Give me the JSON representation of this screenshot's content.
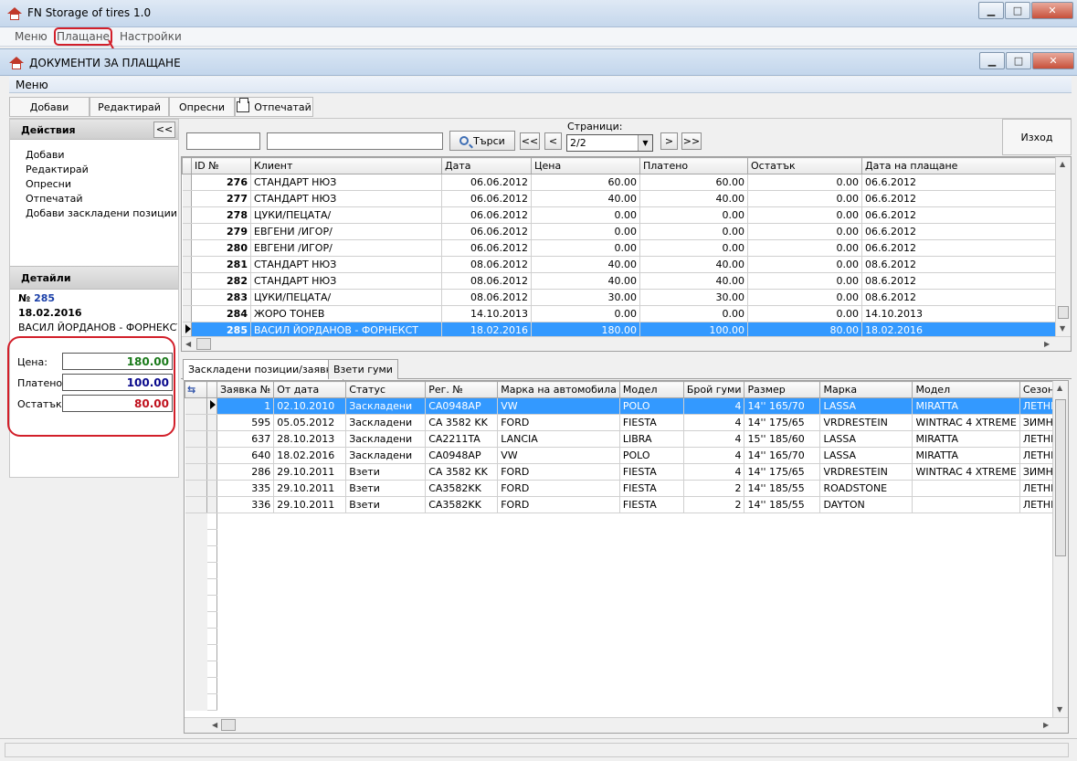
{
  "app": {
    "title": "FN Storage of tires 1.0",
    "menu": [
      "Меню",
      "Плащане",
      "Настройки"
    ]
  },
  "window": {
    "title": "ДОКУМЕНТИ ЗА ПЛАЩАНЕ",
    "menu": "Меню",
    "minimize_glyph": "▁",
    "maximize_glyph": "□",
    "close_glyph": "✕"
  },
  "toolbar": {
    "add": "Добави",
    "edit": "Редактирай",
    "refresh": "Опресни",
    "print": "Отпечатай"
  },
  "actions": {
    "title": "Действия",
    "collapse": "<<",
    "items": [
      "Добави",
      "Редактирай",
      "Опресни",
      "Отпечатай",
      "Добави заскладени позиции"
    ]
  },
  "details": {
    "title": "Детайли",
    "number_prefix": "№",
    "number": "285",
    "date": "18.02.2016",
    "client": "ВАСИЛ ЙОРДАНОВ - ФОРНЕКСТ",
    "price_label": "Цена:",
    "price": "180.00",
    "paid_label": "Платено:",
    "paid": "100.00",
    "remaining_label": "Остатък:",
    "remaining": "80.00"
  },
  "search": {
    "button": "Търси",
    "pages_label": "Страници:",
    "first": "<<",
    "prev": "<",
    "next": ">",
    "last": ">>",
    "page_value": "2/2",
    "exit": "Изход"
  },
  "documents": {
    "columns": [
      "ID №",
      "Клиент",
      "Дата",
      "Цена",
      "Платено",
      "Остатък",
      "Дата на плащане"
    ],
    "rows": [
      [
        "276",
        "СТАНДАРТ НЮЗ",
        "06.06.2012",
        "60.00",
        "60.00",
        "0.00",
        "06.6.2012"
      ],
      [
        "277",
        "СТАНДАРТ НЮЗ",
        "06.06.2012",
        "40.00",
        "40.00",
        "0.00",
        "06.6.2012"
      ],
      [
        "278",
        "ЦУКИ/ПЕЦАТА/",
        "06.06.2012",
        "0.00",
        "0.00",
        "0.00",
        "06.6.2012"
      ],
      [
        "279",
        "ЕВГЕНИ /ИГОР/",
        "06.06.2012",
        "0.00",
        "0.00",
        "0.00",
        "06.6.2012"
      ],
      [
        "280",
        "ЕВГЕНИ /ИГОР/",
        "06.06.2012",
        "0.00",
        "0.00",
        "0.00",
        "06.6.2012"
      ],
      [
        "281",
        "СТАНДАРТ НЮЗ",
        "08.06.2012",
        "40.00",
        "40.00",
        "0.00",
        "08.6.2012"
      ],
      [
        "282",
        "СТАНДАРТ НЮЗ",
        "08.06.2012",
        "40.00",
        "40.00",
        "0.00",
        "08.6.2012"
      ],
      [
        "283",
        "ЦУКИ/ПЕЦАТА/",
        "08.06.2012",
        "30.00",
        "30.00",
        "0.00",
        "08.6.2012"
      ],
      [
        "284",
        "ЖОРО ТОНЕВ",
        "14.10.2013",
        "0.00",
        "0.00",
        "0.00",
        "14.10.2013"
      ],
      [
        "285",
        "ВАСИЛ ЙОРДАНОВ - ФОРНЕКСТ",
        "18.02.2016",
        "180.00",
        "100.00",
        "80.00",
        "18.02.2016"
      ]
    ],
    "selected_index": 9
  },
  "tabs": [
    "Заскладени позиции/заявки",
    "Взети гуми"
  ],
  "positions": {
    "columns": [
      "Заявка №",
      "От дата",
      "Статус",
      "Рег. №",
      "Марка на автомобила",
      "Модел",
      "Брой гуми",
      "Размер",
      "Марка",
      "Модел",
      "Сезон"
    ],
    "rows": [
      [
        "1",
        "02.10.2010",
        "Заскладени",
        "CA0948AP",
        "VW",
        "POLO",
        "4",
        "14'' 165/70",
        "LASSA",
        "MIRATTA",
        "ЛЕТНИ"
      ],
      [
        "595",
        "05.05.2012",
        "Заскладени",
        "CA 3582 KK",
        "FORD",
        "FIESTA",
        "4",
        "14'' 175/65",
        "VRDRESTEIN",
        "WINTRAC 4 XTREME",
        "ЗИМНИ"
      ],
      [
        "637",
        "28.10.2013",
        "Заскладени",
        "CA2211TA",
        "LANCIA",
        "LIBRA",
        "4",
        "15'' 185/60",
        "LASSA",
        "MIRATTA",
        "ЛЕТНИ"
      ],
      [
        "640",
        "18.02.2016",
        "Заскладени",
        "CA0948AP",
        "VW",
        "POLO",
        "4",
        "14'' 165/70",
        "LASSA",
        "MIRATTA",
        "ЛЕТНИ"
      ],
      [
        "286",
        "29.10.2011",
        "Взети",
        "CA 3582 KK",
        "FORD",
        "FIESTA",
        "4",
        "14'' 175/65",
        "VRDRESTEIN",
        "WINTRAC 4 XTREME",
        "ЗИМНИ"
      ],
      [
        "335",
        "29.10.2011",
        "Взети",
        "CA3582KK",
        "FORD",
        "FIESTA",
        "2",
        "14'' 185/55",
        "ROADSTONE",
        "",
        "ЛЕТНИ"
      ],
      [
        "336",
        "29.10.2011",
        "Взети",
        "CA3582KK",
        "FORD",
        "FIESTA",
        "2",
        "14'' 185/55",
        "DAYTON",
        "",
        "ЛЕТНИ"
      ]
    ],
    "selected_index": 0
  },
  "colors": {
    "selection": "#3399ff",
    "price": "#1a7a1a",
    "paid": "#0a0a8c",
    "remaining": "#c0121e",
    "highlight": "#d21f2a"
  },
  "icons": [
    "app-icon",
    "printer-icon",
    "search-icon",
    "column-chooser-icon",
    "row-indicator-icon"
  ]
}
